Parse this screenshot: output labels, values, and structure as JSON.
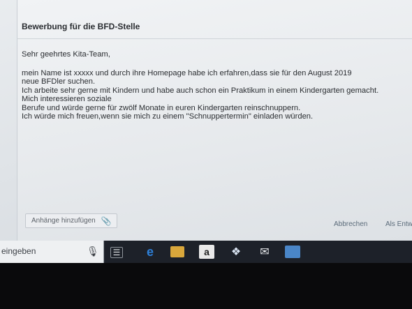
{
  "email": {
    "subject": "Bewerbung für die BFD-Stelle",
    "greeting": "Sehr geehrtes Kita-Team,",
    "body_lines": [
      "mein Name ist xxxxx und durch ihre Homepage habe ich erfahren,dass sie für den August 2019",
      "neue BFDler suchen.",
      "Ich arbeite sehr gerne mit Kindern und habe auch schon  ein Praktikum in einem Kindergarten gemacht.",
      "Mich interessieren soziale",
      "Berufe und würde gerne für zwölf Monate in euren Kindergarten reinschnuppern.",
      "Ich würde mich freuen,wenn sie mich zu einem \"Schnuppertermin\" einladen würden."
    ],
    "attach_label": "Anhänge hinzufügen",
    "cancel_label": "Abbrechen",
    "draft_label": "Als Entw"
  },
  "taskbar": {
    "search_text": "eingeben",
    "amazon_letter": "a",
    "icons": [
      "microphone-icon",
      "task-view-icon",
      "edge-icon",
      "file-explorer-icon",
      "amazon-icon",
      "dropbox-icon",
      "mail-icon",
      "media-icon"
    ]
  }
}
